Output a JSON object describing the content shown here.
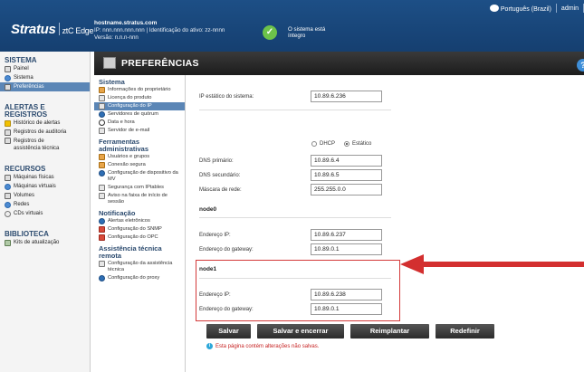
{
  "header": {
    "logo": "Stratus",
    "logo_sub": "ztC Edge",
    "hostname": "hostname.stratus.com",
    "ip_line": "IP: nnn.nnn.nnn.nnn | Identificação do ativo: zz-nnnn",
    "version": "Versão: n.n.n-nnn",
    "status_line1": "O sistema está",
    "status_line2": "íntegro",
    "language": "Português (Brazil)",
    "user": "admin"
  },
  "sidebar": {
    "sections": [
      {
        "title": "SISTEMA",
        "items": [
          {
            "label": "Painel",
            "icon": "dashboard-icon"
          },
          {
            "label": "Sistema",
            "icon": "system-icon"
          },
          {
            "label": "Preferências",
            "icon": "preferences-icon",
            "active": true
          }
        ]
      },
      {
        "title": "ALERTAS E REGISTROS",
        "items": [
          {
            "label": "Histórico de alertas",
            "icon": "alert-icon"
          },
          {
            "label": "Registros de auditoria",
            "icon": "audit-icon"
          },
          {
            "label": "Registros de assistência técnica",
            "icon": "support-log-icon"
          }
        ]
      },
      {
        "title": "RECURSOS",
        "items": [
          {
            "label": "Máquinas físicas",
            "icon": "physical-machine-icon"
          },
          {
            "label": "Máquinas virtuais",
            "icon": "virtual-machine-icon"
          },
          {
            "label": "Volumes",
            "icon": "volume-icon"
          },
          {
            "label": "Redes",
            "icon": "network-icon"
          },
          {
            "label": "CDs virtuais",
            "icon": "cd-icon"
          }
        ]
      },
      {
        "title": "BIBLIOTECA",
        "items": [
          {
            "label": "Kits de atualização",
            "icon": "upgrade-kit-icon"
          }
        ]
      }
    ]
  },
  "page": {
    "title": "PREFERÊNCIAS",
    "help": "?"
  },
  "subnav": {
    "sections": [
      {
        "title": "Sistema",
        "items": [
          {
            "label": "Informações do proprietário",
            "icon": "owner-icon"
          },
          {
            "label": "Licença do produto",
            "icon": "license-icon"
          },
          {
            "label": "Configuração do IP",
            "icon": "ip-config-icon",
            "active": true
          },
          {
            "label": "Servidores de quórum",
            "icon": "quorum-icon"
          },
          {
            "label": "Data e hora",
            "icon": "clock-icon"
          },
          {
            "label": "Servidor de e-mail",
            "icon": "mail-server-icon"
          }
        ]
      },
      {
        "title": "Ferramentas administrativas",
        "items": [
          {
            "label": "Usuários e grupos",
            "icon": "users-icon"
          },
          {
            "label": "Conexão segura",
            "icon": "lock-icon"
          },
          {
            "label": "Configuração de dispositivo da MV",
            "icon": "vm-device-icon"
          },
          {
            "label": "Segurança com IPtables",
            "icon": "iptables-icon"
          },
          {
            "label": "Aviso na faixa de início de sessão",
            "icon": "banner-icon"
          }
        ]
      },
      {
        "title": "Notificação",
        "items": [
          {
            "label": "Alertas eletrônicos",
            "icon": "ealert-icon"
          },
          {
            "label": "Configuração do SNMP",
            "icon": "snmp-icon"
          },
          {
            "label": "Configuração do OPC",
            "icon": "opc-icon"
          }
        ]
      },
      {
        "title": "Assistência técnica remota",
        "items": [
          {
            "label": "Configuração da assistência técnica",
            "icon": "support-config-icon"
          },
          {
            "label": "Configuração do proxy",
            "icon": "proxy-icon"
          }
        ]
      }
    ]
  },
  "form": {
    "system_ip_label": "IP estático do sistema:",
    "system_ip": "10.89.6.236",
    "dhcp_label": "DHCP",
    "static_label": "Estático",
    "mode": "static",
    "dns1_label": "DNS primário:",
    "dns1": "10.89.6.4",
    "dns2_label": "DNS secundário:",
    "dns2": "10.89.6.5",
    "mask_label": "Máscara de rede:",
    "mask": "255.255.0.0",
    "node0_title": "node0",
    "node0_ip_label": "Endereço IP:",
    "node0_ip": "10.89.6.237",
    "node0_gw_label": "Endereço do gateway:",
    "node0_gw": "10.89.0.1",
    "node1_title": "node1",
    "node1_ip_label": "Endereço IP:",
    "node1_ip": "10.89.6.238",
    "node1_gw_label": "Endereço do gateway:",
    "node1_gw": "10.89.0.1"
  },
  "buttons": {
    "save": "Salvar",
    "save_close": "Salvar e encerrar",
    "redeploy": "Reimplantar",
    "reset": "Redefinir"
  },
  "notice": "Esta página contém alterações não salvas.",
  "colors": {
    "header": "#1d4f86",
    "active": "#5b86b6",
    "highlight": "#d33a3a",
    "status_ok": "#6cc24a"
  }
}
